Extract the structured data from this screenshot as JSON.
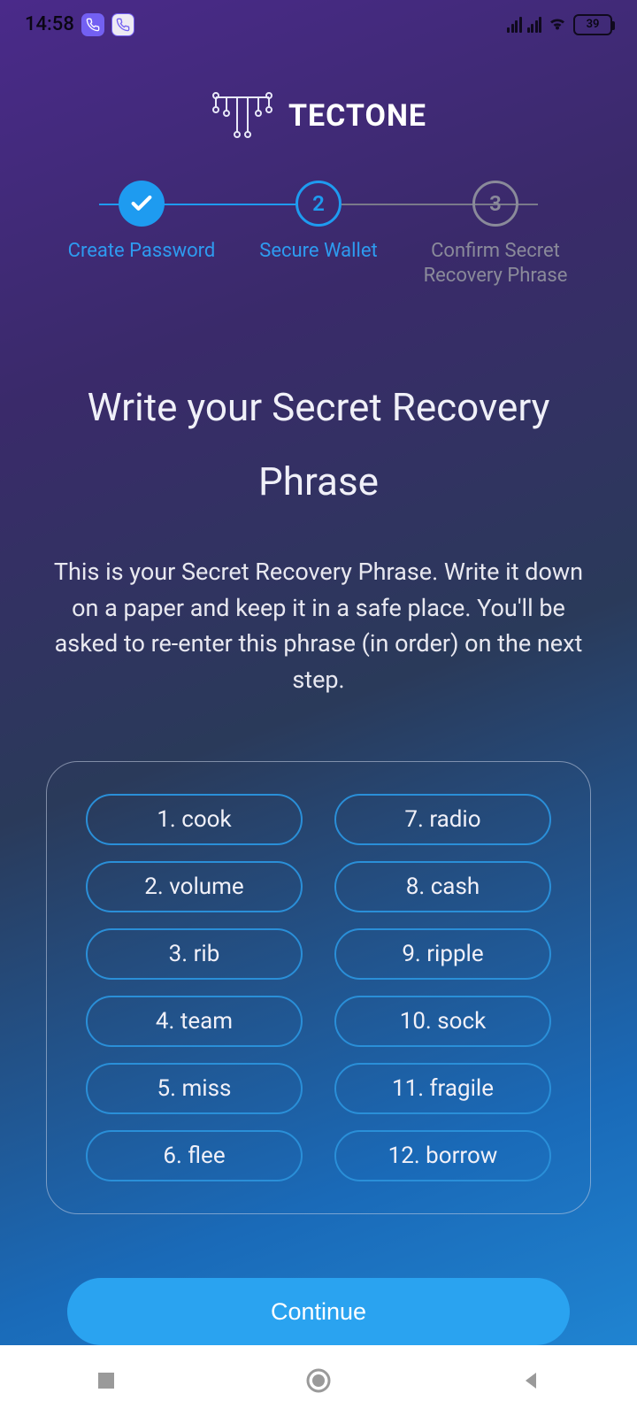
{
  "status": {
    "time": "14:58",
    "battery": "39"
  },
  "app": {
    "name": "TECTONE"
  },
  "stepper": {
    "steps": [
      {
        "label": "Create Password",
        "state": "done"
      },
      {
        "label": "Secure Wallet",
        "state": "current",
        "num": "2"
      },
      {
        "label": "Confirm Secret Recovery Phrase",
        "state": "pending",
        "num": "3"
      }
    ]
  },
  "page": {
    "title": "Write your Secret Recovery Phrase",
    "description": "This is your Secret Recovery Phrase. Write it down on a paper and keep it in a safe place. You'll be asked to re-enter this phrase (in order) on the next step."
  },
  "phrase": {
    "words": [
      "1. cook",
      "7. radio",
      "2. volume",
      "8. cash",
      "3. rib",
      "9. ripple",
      "4. team",
      "10. sock",
      "5. miss",
      "11. fragile",
      "6. flee",
      "12. borrow"
    ]
  },
  "actions": {
    "continue": "Continue"
  }
}
